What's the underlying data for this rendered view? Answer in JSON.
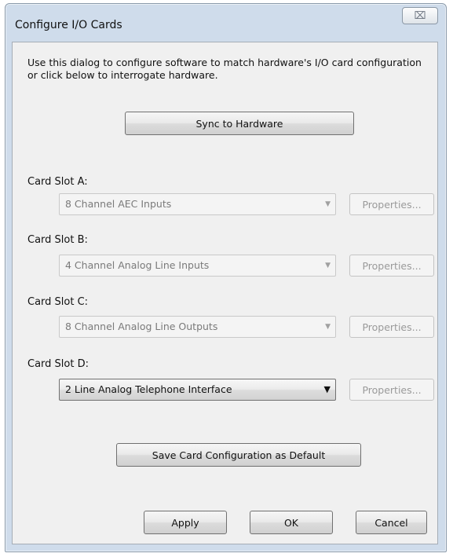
{
  "dialog": {
    "title": "Configure I/O Cards",
    "close_glyph": "⌧"
  },
  "instructions": "Use this dialog to configure software to match hardware's I/O card configuration or click below to interrogate hardware.",
  "sync_button": "Sync to Hardware",
  "slots": [
    {
      "label": "Card Slot A:",
      "value": "8 Channel AEC Inputs",
      "enabled": false,
      "properties": "Properties..."
    },
    {
      "label": "Card Slot B:",
      "value": "4 Channel Analog Line Inputs",
      "enabled": false,
      "properties": "Properties..."
    },
    {
      "label": "Card Slot C:",
      "value": "8 Channel Analog Line Outputs",
      "enabled": false,
      "properties": "Properties..."
    },
    {
      "label": "Card Slot D:",
      "value": "2 Line Analog Telephone Interface",
      "enabled": true,
      "properties": "Properties..."
    }
  ],
  "save_default_button": "Save Card Configuration as Default",
  "footer": {
    "apply": "Apply",
    "ok": "OK",
    "cancel": "Cancel"
  }
}
